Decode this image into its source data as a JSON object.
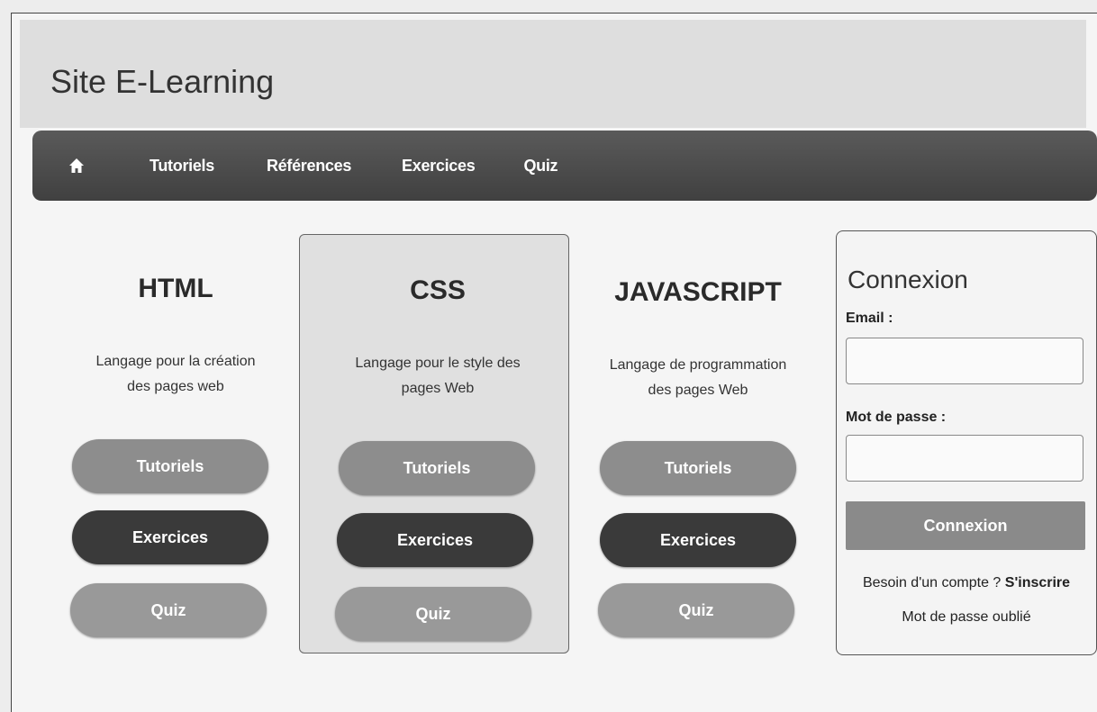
{
  "site": {
    "title": "Site E-Learning"
  },
  "nav": {
    "items": [
      "Tutoriels",
      "Références",
      "Exercices",
      "Quiz"
    ]
  },
  "columns": [
    {
      "title": "HTML",
      "desc_line1": "Langage pour la création",
      "desc_line2": "des pages web",
      "buttons": [
        "Tutoriels",
        "Exercices",
        "Quiz"
      ]
    },
    {
      "title": "CSS",
      "desc_line1": "Langage pour le style des",
      "desc_line2": "pages Web",
      "buttons": [
        "Tutoriels",
        "Exercices",
        "Quiz"
      ]
    },
    {
      "title": "JAVASCRIPT",
      "desc_line1": "Langage de programmation",
      "desc_line2": "des pages Web",
      "buttons": [
        "Tutoriels",
        "Exercices",
        "Quiz"
      ]
    }
  ],
  "login": {
    "title": "Connexion",
    "email_label": "Email :",
    "email_value": "",
    "password_label": "Mot de passe :",
    "password_value": "",
    "submit_label": "Connexion",
    "signup_prompt": "Besoin d'un compte ?",
    "signup_link": "S'inscrire",
    "forgot_link": "Mot de passe oublié"
  },
  "icons": {
    "home": "home-icon"
  },
  "colors": {
    "navbar": "#4a4a4a",
    "button_dark": "#3a3a3a",
    "button_mid": "#8d8d8d",
    "panel": "#e0e0e0"
  }
}
